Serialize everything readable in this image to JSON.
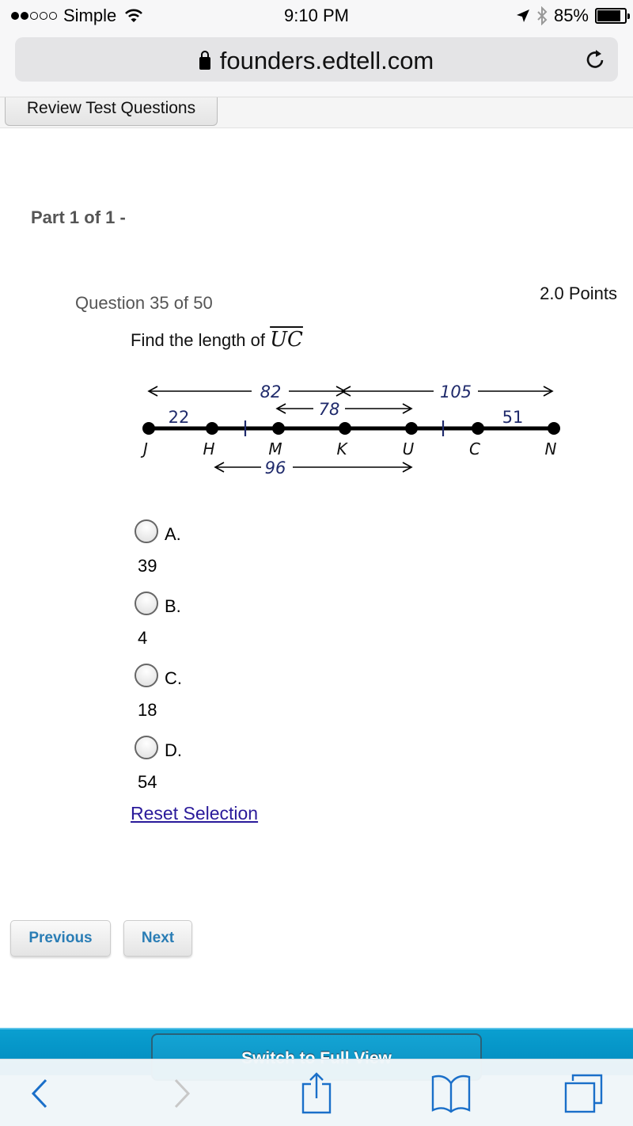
{
  "status_bar": {
    "carrier": "Simple",
    "signal_bars_filled": 2,
    "signal_bars_total": 5,
    "time": "9:10 PM",
    "battery_percent_label": "85%",
    "battery_level": 0.85
  },
  "browser": {
    "url": "founders.edtell.com",
    "icons": {
      "lock": "lock-icon",
      "reload": "reload-icon"
    }
  },
  "page": {
    "review_button": "Review Test Questions",
    "part_title": "Part 1 of 1 -",
    "question_number": "Question 35 of 50",
    "points": "2.0 Points",
    "prompt_text": "Find the length of ",
    "prompt_segment": "UC",
    "diagram": {
      "points": [
        "J",
        "H",
        "M",
        "K",
        "U",
        "C",
        "N"
      ],
      "labels": {
        "jh": "22",
        "jk": "82",
        "kn": "105",
        "mu": "78",
        "cn": "51",
        "hu": "96"
      }
    },
    "choices": [
      {
        "letter": "A.",
        "value": "39"
      },
      {
        "letter": "B.",
        "value": "4"
      },
      {
        "letter": "C.",
        "value": "18"
      },
      {
        "letter": "D.",
        "value": "54"
      }
    ],
    "reset_link": "Reset Selection",
    "previous_button": "Previous",
    "next_button": "Next",
    "full_view_button": "Switch to Full View"
  },
  "toolbar": {
    "back": "back-icon",
    "forward": "forward-icon",
    "share": "share-icon",
    "bookmarks": "bookmarks-icon",
    "tabs": "tabs-icon"
  },
  "colors": {
    "link": "#2a1a9a",
    "nav_button_text": "#2a7db5",
    "footer_blue": "#0a9fd0",
    "diagram_label": "#1f2a6b",
    "toolbar_icon": "#1a6fc9"
  }
}
